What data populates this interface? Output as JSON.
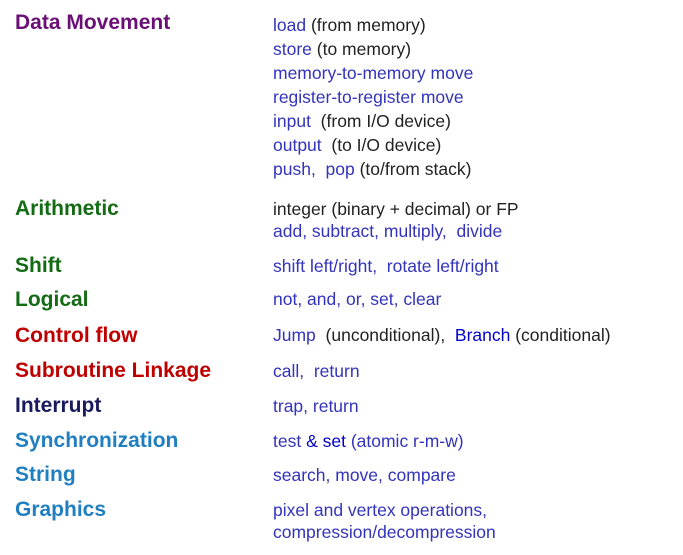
{
  "colors": {
    "purple": "#6a0f75",
    "green": "#136b13",
    "red": "#c00000",
    "navy": "#1a1a5e",
    "teal": "#1f7fc0",
    "instruction_blue": "#3333bb",
    "description_black": "#222222"
  },
  "categories": [
    {
      "name": "Data Movement",
      "lines": [
        [
          {
            "t": "load",
            "c": "b"
          },
          {
            "t": " (from memory)",
            "c": "k"
          }
        ],
        [
          {
            "t": "store",
            "c": "b"
          },
          {
            "t": " (to memory)",
            "c": "k"
          }
        ],
        [
          {
            "t": "memory-to-memory move",
            "c": "b"
          }
        ],
        [
          {
            "t": "register-to-register move",
            "c": "b"
          }
        ],
        [
          {
            "t": "input",
            "c": "b"
          },
          {
            "t": "  (from I/O device)",
            "c": "k"
          }
        ],
        [
          {
            "t": "output",
            "c": "b"
          },
          {
            "t": "  (to I/O device)",
            "c": "k"
          }
        ],
        [
          {
            "t": "push,  pop",
            "c": "b"
          },
          {
            "t": " (to/from stack)",
            "c": "k"
          }
        ]
      ]
    },
    {
      "name": "Arithmetic",
      "lines": [
        [
          {
            "t": "integer (binary + decimal) or FP",
            "c": "k"
          }
        ],
        [
          {
            "t": "add, subtract, multiply,  divide",
            "c": "b"
          }
        ]
      ]
    },
    {
      "name": "Shift",
      "lines": [
        [
          {
            "t": "shift left/right,  rotate left/right",
            "c": "b"
          }
        ]
      ]
    },
    {
      "name": "Logical",
      "lines": [
        [
          {
            "t": "not, and, or, set, clear",
            "c": "b"
          }
        ]
      ]
    },
    {
      "name": "Control flow",
      "lines": [
        [
          {
            "t": "Jump",
            "c": "b"
          },
          {
            "t": "  (unconditional),  ",
            "c": "k"
          },
          {
            "t": "Branch",
            "c": "bb"
          },
          {
            "t": " (conditional)",
            "c": "k"
          }
        ]
      ]
    },
    {
      "name": "Subroutine Linkage",
      "lines": [
        [
          {
            "t": "call,  return",
            "c": "b"
          }
        ]
      ]
    },
    {
      "name": "Interrupt",
      "lines": [
        [
          {
            "t": "trap, return",
            "c": "b"
          }
        ]
      ]
    },
    {
      "name": "Synchronization",
      "lines": [
        [
          {
            "t": "test",
            "c": "b"
          },
          {
            "t": " & set ",
            "c": "bb"
          },
          {
            "t": "(atomic r-m-w)",
            "c": "b"
          }
        ]
      ]
    },
    {
      "name": "String",
      "lines": [
        [
          {
            "t": "search, move, compare",
            "c": "b"
          }
        ]
      ]
    },
    {
      "name": "Graphics",
      "lines": [
        [
          {
            "t": "pixel and vertex operations,",
            "c": "b"
          }
        ],
        [
          {
            "t": "compression/decompression",
            "c": "b"
          }
        ]
      ]
    }
  ]
}
